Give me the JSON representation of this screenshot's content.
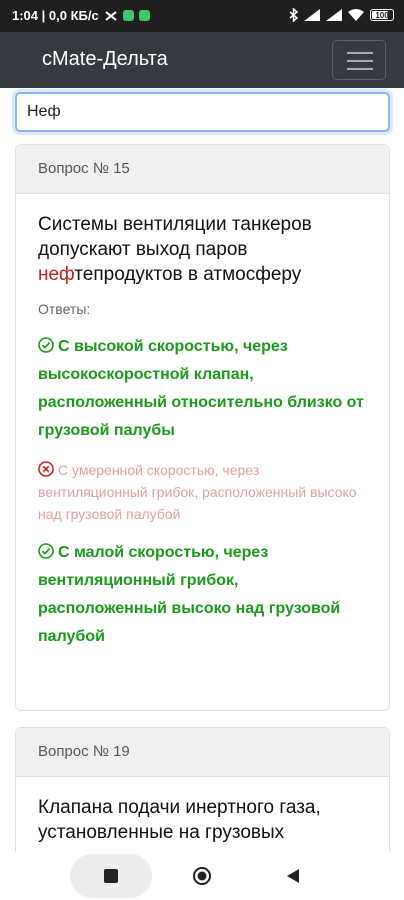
{
  "status_bar": {
    "time_info": "1:04 | 0,0 КБ/с",
    "battery": "100"
  },
  "navbar": {
    "brand": "cMate-Дельта"
  },
  "search": {
    "value": "Неф"
  },
  "cards": [
    {
      "header": "Вопрос № 15",
      "question_pre": "Системы вентиляции танкеров допускают выход паров ",
      "question_highlight": "неф",
      "question_post": "тепродуктов в атмосферу",
      "answers_label": "Ответы:",
      "answers": [
        {
          "text": "С высокой скоростью, через высокоскоростной клапан, расположенный относительно близко от грузовой палубы",
          "correct": true
        },
        {
          "text": "С умеренной скоростью, через вентиляционный грибок, расположенный высоко над грузовой палубой",
          "correct": false
        },
        {
          "text": "С малой скоростью, через вентиляционный грибок, расположенный высоко над грузовой палубой",
          "correct": true
        }
      ]
    },
    {
      "header": "Вопрос № 19",
      "question": "Клапана подачи инертного газа, установленные на грузовых"
    }
  ],
  "colors": {
    "correct": "#1a9b1a",
    "wrong": "#e0a0a0",
    "highlight": "#c02020",
    "navbar": "#343a40"
  },
  "icons": [
    "wifi-icon",
    "signal-icon",
    "bluetooth-icon",
    "menu-icon",
    "check-circle-icon",
    "x-circle-icon",
    "square-icon",
    "home-circle-icon",
    "back-triangle-icon"
  ]
}
